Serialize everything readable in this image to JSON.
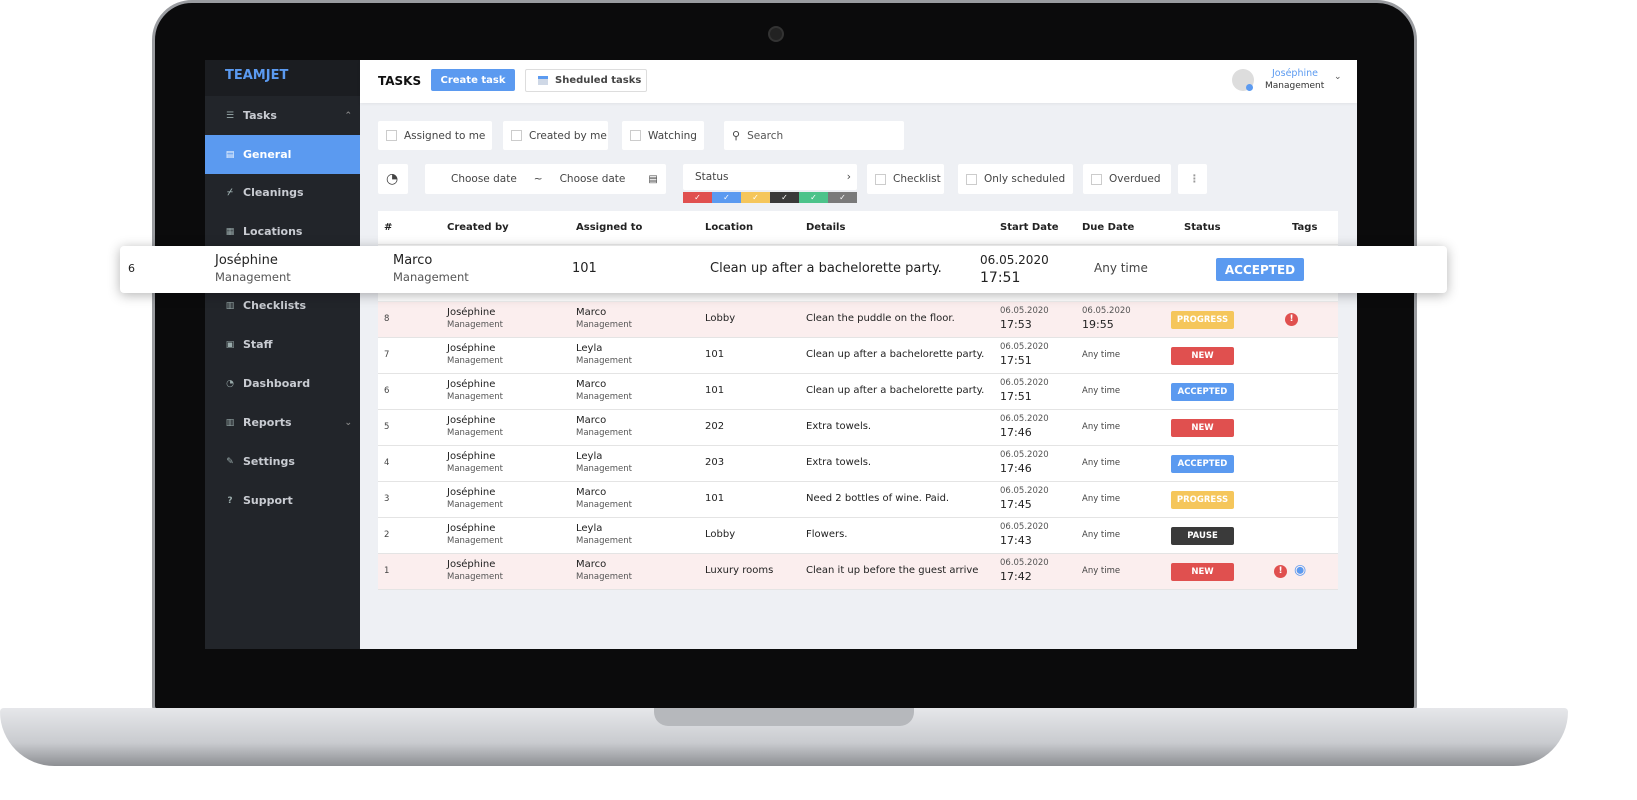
{
  "app": {
    "logo": "TEAMJET"
  },
  "sidebar": {
    "items": [
      {
        "label": "Tasks",
        "icon": "list-icon"
      },
      {
        "label": "General",
        "icon": "stack-icon",
        "active": true
      },
      {
        "label": "Cleanings",
        "icon": "broom-icon"
      },
      {
        "label": "Locations",
        "icon": "grid-icon"
      },
      {
        "label": "Checklists",
        "icon": "checklist-icon"
      },
      {
        "label": "Staff",
        "icon": "person-icon"
      },
      {
        "label": "Dashboard",
        "icon": "pie-icon"
      },
      {
        "label": "Reports",
        "icon": "bar-chart-icon"
      },
      {
        "label": "Settings",
        "icon": "edit-icon"
      },
      {
        "label": "Support",
        "icon": "question-icon"
      }
    ]
  },
  "header": {
    "title": "TASKS",
    "create_task": "Create task",
    "scheduled_tasks": "Sheduled tasks",
    "user": {
      "name": "Joséphine",
      "role": "Management"
    }
  },
  "filters": {
    "assigned_to_me": "Assigned to me",
    "created_by_me": "Created by me",
    "watching": "Watching",
    "search_placeholder": "Search",
    "date_from": "Choose date",
    "date_sep": "~",
    "date_to": "Choose date",
    "status": "Status",
    "status_colors": [
      "#e0504f",
      "#5b9af0",
      "#f5c65b",
      "#3a3a3a",
      "#4cc38a",
      "#7a7a7a"
    ],
    "checklist": "Checklist",
    "only_scheduled": "Only scheduled",
    "overdued": "Overdued"
  },
  "table": {
    "columns": [
      "#",
      "Created by",
      "Assigned to",
      "Location",
      "Details",
      "Start Date",
      "Due Date",
      "Status",
      "Tags"
    ],
    "rows": [
      {
        "id": "8",
        "creator": "Joséphine",
        "creator_role": "Management",
        "assignee": "Marco",
        "assignee_role": "Management",
        "location": "Lobby",
        "details": "Clean the puddle on the floor.",
        "start_date": "06.05.2020",
        "start_time": "17:53",
        "due_date": "06.05.2020",
        "due_time": "19:55",
        "status": "PROGRESS",
        "status_color": "#f5c65b",
        "highlight": true,
        "tags": [
          "alert"
        ]
      },
      {
        "id": "7",
        "creator": "Joséphine",
        "creator_role": "Management",
        "assignee": "Leyla",
        "assignee_role": "Management",
        "location": "101",
        "details": "Clean up after a bachelorette party.",
        "start_date": "06.05.2020",
        "start_time": "17:51",
        "due": "Any time",
        "status": "NEW",
        "status_color": "#e0504f"
      },
      {
        "id": "6",
        "creator": "Joséphine",
        "creator_role": "Management",
        "assignee": "Marco",
        "assignee_role": "Management",
        "location": "101",
        "details": "Clean up after a bachelorette party.",
        "start_date": "06.05.2020",
        "start_time": "17:51",
        "due": "Any time",
        "status": "ACCEPTED",
        "status_color": "#5b9af0"
      },
      {
        "id": "5",
        "creator": "Joséphine",
        "creator_role": "Management",
        "assignee": "Marco",
        "assignee_role": "Management",
        "location": "202",
        "details": "Extra towels.",
        "start_date": "06.05.2020",
        "start_time": "17:46",
        "due": "Any time",
        "status": "NEW",
        "status_color": "#e0504f"
      },
      {
        "id": "4",
        "creator": "Joséphine",
        "creator_role": "Management",
        "assignee": "Leyla",
        "assignee_role": "Management",
        "location": "203",
        "details": "Extra towels.",
        "start_date": "06.05.2020",
        "start_time": "17:46",
        "due": "Any time",
        "status": "ACCEPTED",
        "status_color": "#5b9af0"
      },
      {
        "id": "3",
        "creator": "Joséphine",
        "creator_role": "Management",
        "assignee": "Marco",
        "assignee_role": "Management",
        "location": "101",
        "details": "Need 2 bottles of wine. Paid.",
        "start_date": "06.05.2020",
        "start_time": "17:45",
        "due": "Any time",
        "status": "PROGRESS",
        "status_color": "#f5c65b"
      },
      {
        "id": "2",
        "creator": "Joséphine",
        "creator_role": "Management",
        "assignee": "Leyla",
        "assignee_role": "Management",
        "location": "Lobby",
        "details": "Flowers.",
        "start_date": "06.05.2020",
        "start_time": "17:43",
        "due": "Any time",
        "status": "PAUSE",
        "status_color": "#3a3a3a"
      },
      {
        "id": "1",
        "creator": "Joséphine",
        "creator_role": "Management",
        "assignee": "Marco",
        "assignee_role": "Management",
        "location": "Luxury rooms",
        "details": "Clean it up before the guest arrive",
        "start_date": "06.05.2020",
        "start_time": "17:42",
        "due": "Any time",
        "status": "NEW",
        "status_color": "#e0504f",
        "highlight": true,
        "tags": [
          "alert",
          "eye"
        ]
      }
    ]
  },
  "popup_row": {
    "id": "6",
    "creator": "Joséphine",
    "creator_role": "Management",
    "assignee": "Marco",
    "assignee_role": "Management",
    "location": "101",
    "details": "Clean up after a bachelorette party.",
    "start_date": "06.05.2020",
    "start_time": "17:51",
    "due": "Any time",
    "status": "ACCEPTED",
    "status_color": "#5b9af0"
  }
}
